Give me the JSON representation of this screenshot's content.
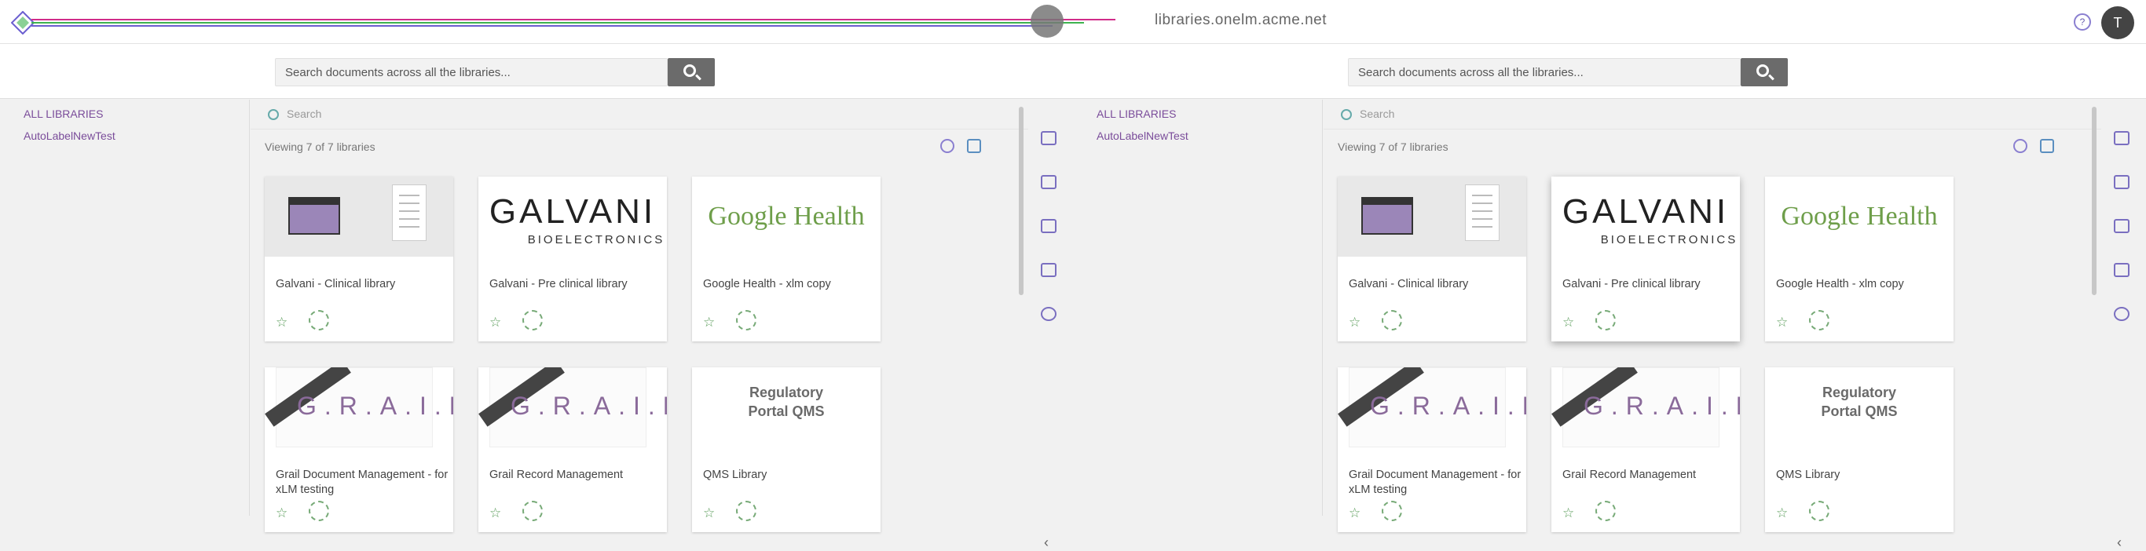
{
  "header": {
    "site_title": "libraries.onelm.acme.net",
    "help_label": "?",
    "avatar_initial": "T",
    "accent_colors": [
      "#d12c8a",
      "#3eb34f",
      "#6b5fd0"
    ]
  },
  "panels": [
    {
      "search": {
        "placeholder": "Search documents across all the libraries...",
        "value": ""
      },
      "sidebar": {
        "items": [
          {
            "label": "ALL LIBRARIES"
          },
          {
            "label": "AutoLabelNewTest"
          }
        ]
      },
      "filter": {
        "placeholder": "Search"
      },
      "viewing_text": "Viewing 7 of 7 libraries",
      "libraries": [
        {
          "name": "Galvani - Clinical library",
          "thumb": "clinical"
        },
        {
          "name": "Galvani - Pre clinical library",
          "thumb": "galvani"
        },
        {
          "name": "Google Health - xlm copy",
          "thumb": "google"
        },
        {
          "name": "Grail Document Management - for xLM testing",
          "thumb": "grail"
        },
        {
          "name": "Grail Record Management",
          "thumb": "grail2"
        },
        {
          "name": "QMS Library",
          "thumb": "qms"
        }
      ]
    },
    {
      "search": {
        "placeholder": "Search documents across all the libraries...",
        "value": ""
      },
      "sidebar": {
        "items": [
          {
            "label": "ALL LIBRARIES"
          },
          {
            "label": "AutoLabelNewTest"
          }
        ]
      },
      "filter": {
        "placeholder": "Search"
      },
      "viewing_text": "Viewing 7 of 7 libraries",
      "libraries": [
        {
          "name": "Galvani - Clinical library",
          "thumb": "clinical"
        },
        {
          "name": "Galvani - Pre clinical library",
          "thumb": "galvani"
        },
        {
          "name": "Google Health - xlm copy",
          "thumb": "google"
        },
        {
          "name": "Grail Document Management - for xLM testing",
          "thumb": "grail"
        },
        {
          "name": "Grail Record Management",
          "thumb": "grail2"
        },
        {
          "name": "QMS Library",
          "thumb": "qms"
        }
      ]
    }
  ],
  "thumb_text": {
    "galvani": "GALVANI",
    "galvani_sub": "BIOELECTRONICS",
    "google": "Google Health",
    "grail": "G.R.A.I.L",
    "qms": "Regulatory Portal QMS"
  },
  "icons": {
    "rail": [
      "filter-icon",
      "folder-icon",
      "grid-icon",
      "list-icon",
      "settings-icon"
    ],
    "collapse": "‹"
  }
}
